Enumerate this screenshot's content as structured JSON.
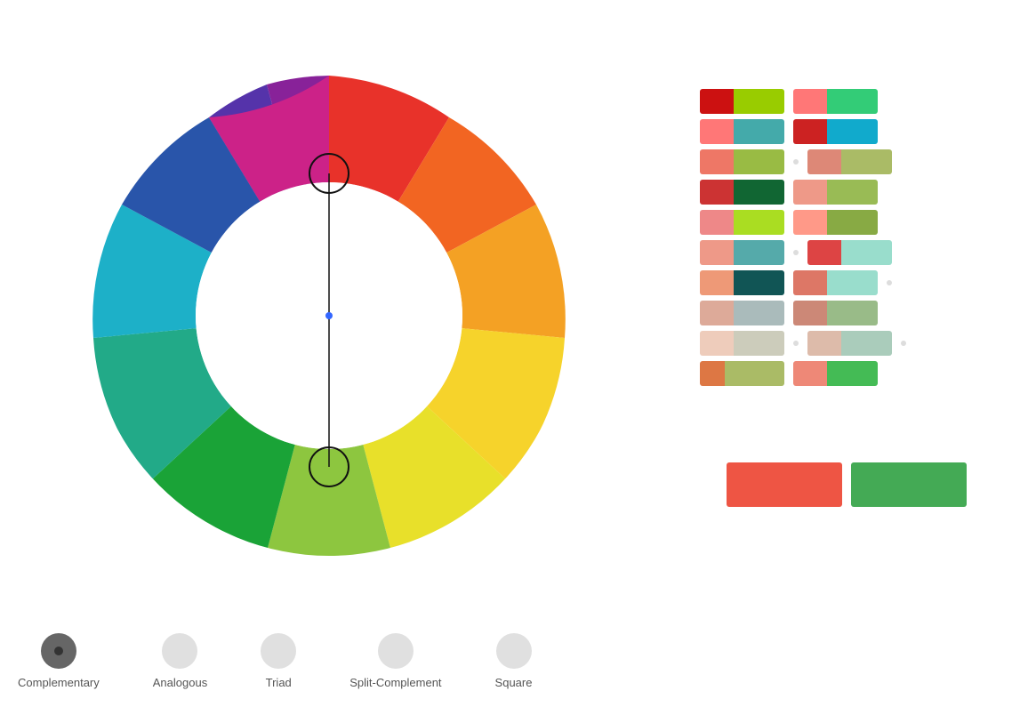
{
  "nav": {
    "items": [
      {
        "id": "complementary",
        "label": "Complementary",
        "active": true
      },
      {
        "id": "analogous",
        "label": "Analogous",
        "active": false
      },
      {
        "id": "triad",
        "label": "Triad",
        "active": false
      },
      {
        "id": "split-complement",
        "label": "Split-Complement",
        "active": false
      },
      {
        "id": "square",
        "label": "Square",
        "active": false
      }
    ]
  },
  "swatches": {
    "rows": [
      [
        {
          "colors": [
            [
              "#cc0000",
              40
            ],
            [
              "#99cc00",
              60
            ]
          ]
        },
        {
          "colors": [
            [
              "#ff6666",
              40
            ],
            [
              "#00cc66",
              60
            ]
          ]
        }
      ],
      [
        {
          "colors": [
            [
              "#ff7777",
              40
            ],
            [
              "#33aaaa",
              60
            ]
          ]
        },
        {
          "colors": [
            [
              "#cc2222",
              40
            ],
            [
              "#00aaaa",
              60
            ]
          ]
        }
      ],
      [
        {
          "colors": [
            [
              "#ee6655",
              40
            ],
            [
              "#99bb44",
              60
            ]
          ],
          "dot": true
        },
        {
          "colors": [
            [
              "#dd7766",
              40
            ],
            [
              "#aaaa55",
              60
            ]
          ]
        }
      ],
      [
        {
          "colors": [
            [
              "#cc3333",
              40
            ],
            [
              "#006633",
              60
            ]
          ]
        },
        {
          "colors": [
            [
              "#ee8877",
              40
            ],
            [
              "#99aa55",
              60
            ]
          ]
        }
      ],
      [
        {
          "colors": [
            [
              "#ee8888",
              40
            ],
            [
              "#aadd22",
              60
            ]
          ]
        },
        {
          "colors": [
            [
              "#ff8877",
              40
            ],
            [
              "#77aa44",
              60
            ]
          ]
        }
      ],
      [
        {
          "colors": [
            [
              "#ee9988",
              40
            ],
            [
              "#55aaaa",
              60
            ]
          ],
          "dot": true
        },
        {
          "colors": [
            [
              "#dd4444",
              40
            ],
            [
              "#99ddbb",
              60
            ]
          ]
        }
      ],
      [
        {
          "colors": [
            [
              "#ee8866",
              40
            ],
            [
              "#115555",
              60
            ]
          ]
        },
        {
          "colors": [
            [
              "#dd6655",
              40
            ],
            [
              "#88ddcc",
              60
            ]
          ],
          "dot": true
        }
      ],
      [
        {
          "colors": [
            [
              "#ddaa99",
              40
            ],
            [
              "#aabbbb",
              60
            ]
          ]
        },
        {
          "colors": [
            [
              "#cc7766",
              40
            ],
            [
              "#99bb88",
              60
            ]
          ]
        }
      ],
      [
        {
          "colors": [
            [
              "#eeccbb",
              40
            ],
            [
              "#ccccbb",
              60
            ]
          ],
          "dot": true
        },
        {
          "colors": [
            [
              "#ddaaaa",
              40
            ],
            [
              "#99ccbb",
              60
            ]
          ],
          "dot": true
        }
      ],
      [
        {
          "colors": [
            [
              "#dd8855",
              30
            ],
            [
              "#aaaa66",
              70
            ]
          ]
        },
        {
          "colors": [
            [
              "#ee8877",
              40
            ],
            [
              "#33bb55",
              60
            ]
          ]
        }
      ]
    ],
    "large": [
      {
        "color": "#ee5544",
        "width": 130
      },
      {
        "color": "#44aa55",
        "width": 130
      }
    ]
  }
}
